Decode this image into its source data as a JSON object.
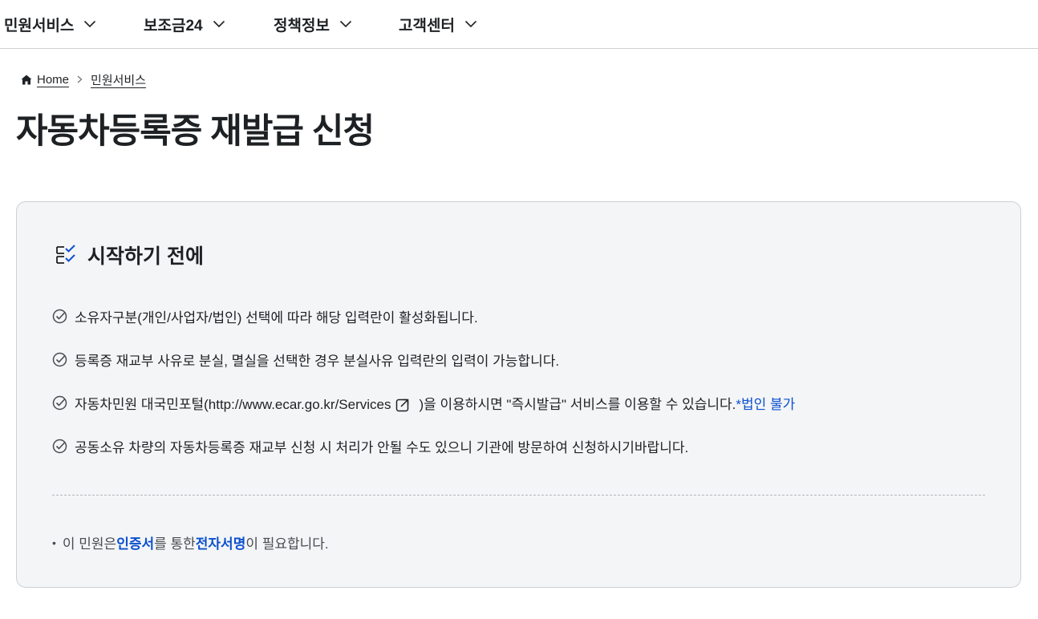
{
  "gnb": {
    "items": [
      {
        "label": "민원서비스",
        "icon": "chevron-down-icon"
      },
      {
        "label": "보조금24",
        "icon": "chevron-down-icon"
      },
      {
        "label": "정책정보",
        "icon": "chevron-down-icon"
      },
      {
        "label": "고객센터",
        "icon": "chevron-down-icon"
      }
    ]
  },
  "breadcrumb": {
    "home": "Home",
    "current": "민원서비스"
  },
  "page_title": "자동차등록증 재발급 신청",
  "card": {
    "title": "시작하기 전에",
    "items": [
      {
        "text": "소유자구분(개인/사업자/법인) 선택에 따라 해당 입력란이 활성화됩니다."
      },
      {
        "text": "등록증 재교부 사유로 분실, 멸실을 선택한 경우 분실사유 입력란의 입력이 가능합니다."
      },
      {
        "text_before": "자동차민원 대국민포털(http://www.ecar.go.kr/Services",
        "text_after": ")을 이용하시면 \"즉시발급\" 서비스를 이용할 수 있습니다.",
        "note": "*법인 불가"
      },
      {
        "text": "공동소유 차량의 자동차등록증 재교부 신청 시 처리가 안될 수도 있으니 기관에 방문하여 신청하시기바랍니다."
      }
    ],
    "notice": {
      "prefix": "이 민원은 ",
      "cert": "인증서",
      "middle": "를 통한 ",
      "sign": "전자서명",
      "suffix": "이 필요합니다."
    }
  },
  "colors": {
    "accent": "#0b50d0",
    "card_bg": "#f4f5f6",
    "text": "#1e2124"
  }
}
